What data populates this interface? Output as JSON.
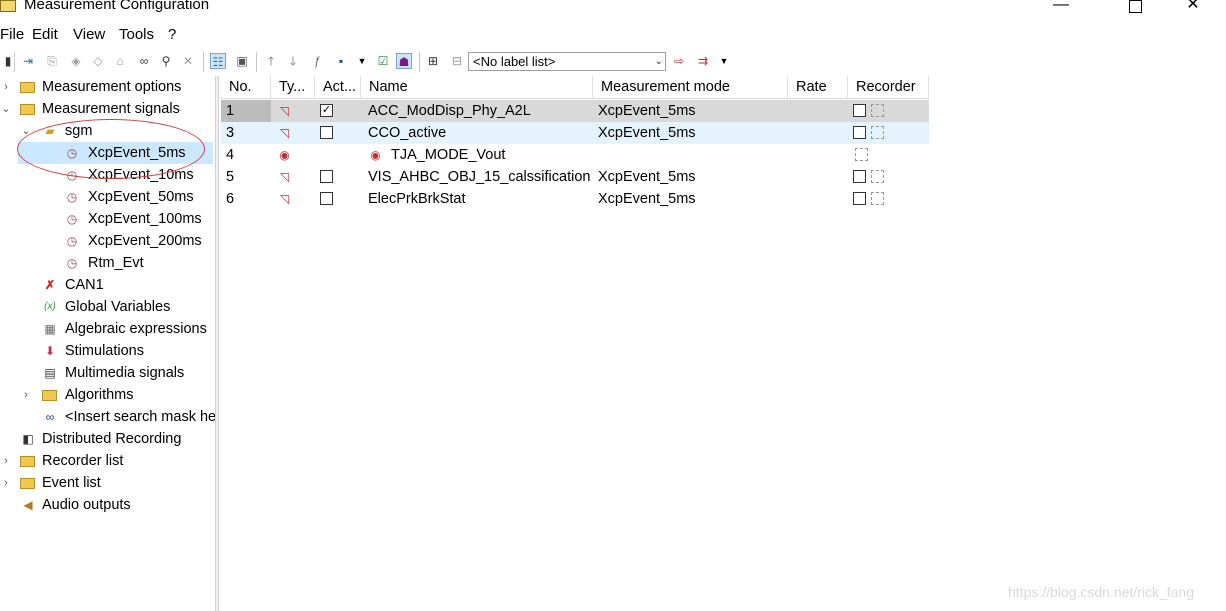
{
  "window": {
    "title": "Measurement Configuration",
    "minimize": "—",
    "close": "✕"
  },
  "menu": [
    "File",
    "Edit",
    "View",
    "Tools",
    "?"
  ],
  "toolbar": {
    "label_list": "<No label list>",
    "icons": [
      "configure-icon",
      "insert-icon",
      "link-icon",
      "unlink-icon",
      "branch-icon",
      "group-icon",
      "binoculars-icon",
      "find-icon",
      "delete-icon",
      "view-tree-icon",
      "view-grid-icon",
      "arrow-up-icon",
      "arrow-down-icon",
      "function-icon",
      "save-icon",
      "dropdown-icon",
      "checkbox-icon",
      "agent-icon",
      "expand-icon",
      "collapse-icon",
      "label-icon",
      "export-icon",
      "dropdown-icon"
    ]
  },
  "tree": {
    "items": [
      {
        "label": "Measurement options",
        "icon": "folder-icon",
        "level": 0,
        "expander": "›"
      },
      {
        "label": "Measurement signals",
        "icon": "folder-icon",
        "level": 0,
        "expander": "⌄"
      },
      {
        "label": "sgm",
        "icon": "device-icon",
        "level": 1,
        "expander": "⌄"
      },
      {
        "label": "XcpEvent_5ms",
        "icon": "timer-icon",
        "level": 2,
        "selected": true
      },
      {
        "label": "XcpEvent_10ms",
        "icon": "timer-icon",
        "level": 2
      },
      {
        "label": "XcpEvent_50ms",
        "icon": "timer-icon",
        "level": 2
      },
      {
        "label": "XcpEvent_100ms",
        "icon": "timer-icon",
        "level": 2
      },
      {
        "label": "XcpEvent_200ms",
        "icon": "timer-icon",
        "level": 2
      },
      {
        "label": "Rtm_Evt",
        "icon": "timer-icon",
        "level": 2
      },
      {
        "label": "CAN1",
        "icon": "can-icon",
        "level": 1
      },
      {
        "label": "Global Variables",
        "icon": "variable-icon",
        "level": 1
      },
      {
        "label": "Algebraic expressions",
        "icon": "calculator-icon",
        "level": 1
      },
      {
        "label": "Stimulations",
        "icon": "stimulation-icon",
        "level": 1
      },
      {
        "label": "Multimedia signals",
        "icon": "film-icon",
        "level": 1
      },
      {
        "label": "Algorithms",
        "icon": "folder-icon",
        "level": 1,
        "expander": "›"
      },
      {
        "label": "<Insert search mask he",
        "icon": "binoculars-icon",
        "level": 1
      },
      {
        "label": "Distributed Recording",
        "icon": "distributed-icon",
        "level": 0
      },
      {
        "label": "Recorder list",
        "icon": "recorder-folder-icon",
        "level": 0,
        "expander": "›"
      },
      {
        "label": "Event list",
        "icon": "event-folder-icon",
        "level": 0,
        "expander": "›"
      },
      {
        "label": "Audio outputs",
        "icon": "speaker-icon",
        "level": 0
      }
    ]
  },
  "grid": {
    "columns": [
      "No.",
      "Ty...",
      "Act...",
      "Name",
      "Measurement mode",
      "Rate",
      "Recorder"
    ],
    "rows": [
      {
        "no": "1",
        "active": true,
        "name": "ACC_ModDisp_Phy_A2L",
        "mode": "XcpEvent_5ms",
        "rate": "",
        "style": "sel"
      },
      {
        "no": "3",
        "active": false,
        "name": "CCO_active",
        "mode": "XcpEvent_5ms",
        "rate": "",
        "style": "alt"
      },
      {
        "no": "4",
        "active": null,
        "name": "TJA_MODE_Vout",
        "mode": "",
        "rate": "",
        "style": "",
        "error": true
      },
      {
        "no": "5",
        "active": false,
        "name": "VIS_AHBC_OBJ_15_calssification",
        "mode": "XcpEvent_5ms",
        "rate": "",
        "style": ""
      },
      {
        "no": "6",
        "active": false,
        "name": "ElecPrkBrkStat",
        "mode": "XcpEvent_5ms",
        "rate": "",
        "style": ""
      }
    ]
  },
  "watermark": "https://blog.csdn.net/rick_fang"
}
